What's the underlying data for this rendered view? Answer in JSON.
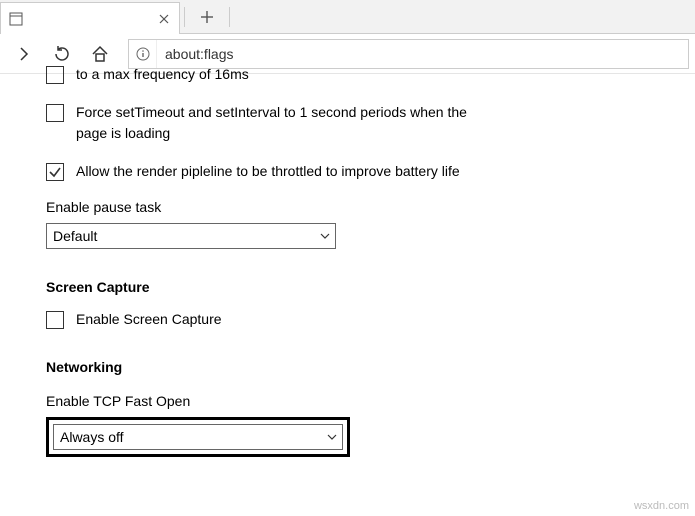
{
  "tab": {
    "title": ""
  },
  "address": {
    "url": "about:flags"
  },
  "options": {
    "opt1_partial": "to a max frequency of 16ms",
    "opt2": "Force setTimeout and setInterval to 1 second periods when the page is loading",
    "opt3": "Allow the render pipleline to be throttled to improve battery life"
  },
  "pause_task": {
    "label": "Enable pause task",
    "selected": "Default"
  },
  "screen_capture": {
    "heading": "Screen Capture",
    "checkbox_label": "Enable Screen Capture"
  },
  "networking": {
    "heading": "Networking",
    "tcp_label": "Enable TCP Fast Open",
    "tcp_selected": "Always off"
  },
  "watermark": "wsxdn.com"
}
